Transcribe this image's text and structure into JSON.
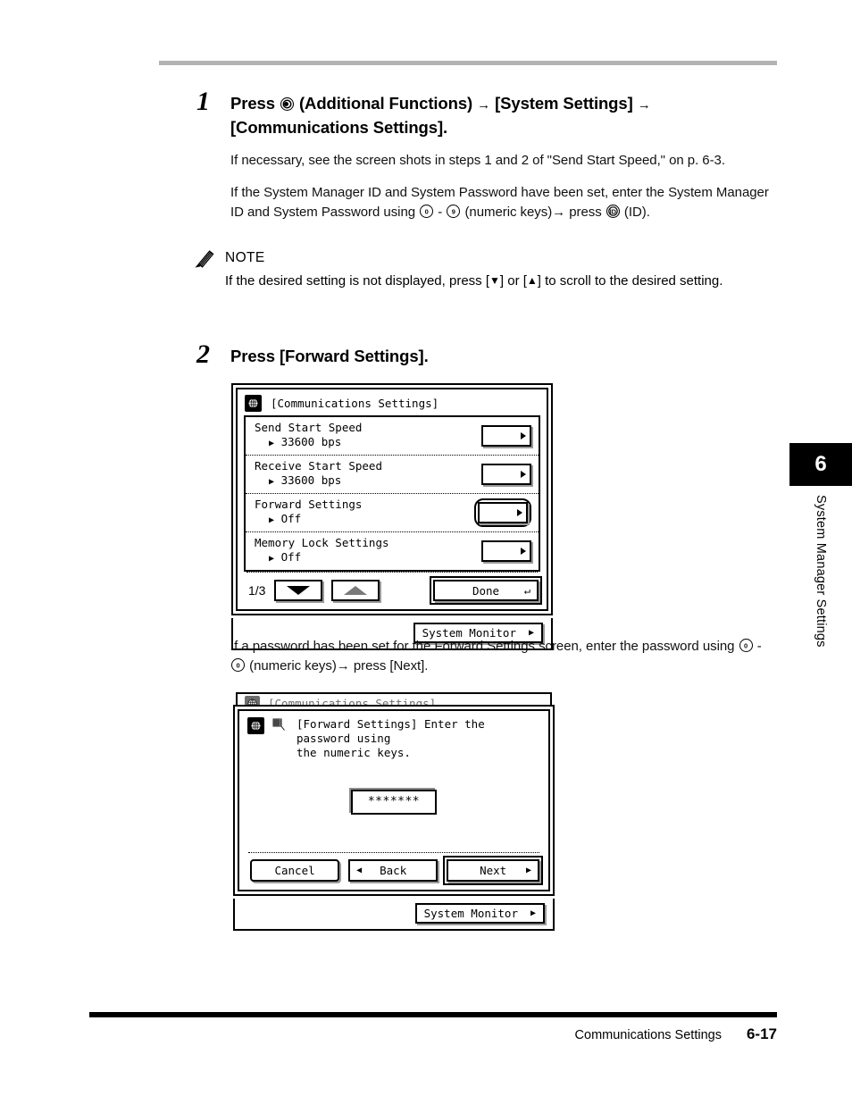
{
  "page": {
    "footer_title": "Communications Settings",
    "footer_page": "6-17",
    "chapter_number": "6",
    "chapter_label": "System Manager Settings"
  },
  "step1": {
    "number": "1",
    "heading_a": "Press",
    "heading_b": "(Additional Functions)",
    "heading_arrow1": "→",
    "heading_c": "[System Settings]",
    "heading_arrow2": "→",
    "heading_d": "[Communications Settings].",
    "para1": "If necessary, see the screen shots in steps 1 and 2 of \"Send Start Speed,\" on p. 6-3.",
    "para2_a": "If the System Manager ID and System Password have been set, enter the System Manager ID and System Password using",
    "para2_key_from": "0",
    "para2_dash": "-",
    "para2_key_to": "9",
    "para2_b": "(numeric keys)",
    "para2_arrow": "→",
    "para2_c": "press",
    "para2_key_id": "ID",
    "para2_d": "(ID)."
  },
  "note": {
    "title": "NOTE",
    "text_a": "If the desired setting is not displayed, press [",
    "down_glyph": "▼",
    "text_b": "] or [",
    "up_glyph": "▲",
    "text_c": "] to scroll to the desired setting."
  },
  "step2": {
    "number": "2",
    "heading": "Press [Forward Settings]."
  },
  "screen1": {
    "title": "[Communications Settings]",
    "rows": [
      {
        "label": "Send Start Speed",
        "value": "33600 bps",
        "highlight": false
      },
      {
        "label": "Receive Start Speed",
        "value": "33600 bps",
        "highlight": false
      },
      {
        "label": "Forward Settings",
        "value": "Off",
        "highlight": true
      },
      {
        "label": "Memory Lock Settings",
        "value": "Off",
        "highlight": false
      }
    ],
    "page_indicator": "1/3",
    "down_button": "scroll-down",
    "up_button": "scroll-up",
    "done_label": "Done",
    "done_return_glyph": "↵",
    "system_monitor_label": "System Monitor",
    "tri_right": "▶",
    "bullet": "▶"
  },
  "mid_para": {
    "text_a": "If a password has been set for the Forward Settings screen, enter the password using",
    "key_from": "0",
    "dash": "-",
    "key_to": "0",
    "text_b": "(numeric keys)",
    "arrow": "→",
    "text_c": "press [Next]."
  },
  "screen2": {
    "ghost_title": "[Communications Settings]",
    "message_line1": "[Forward Settings] Enter the password using",
    "message_line2": "the numeric keys.",
    "password_value": "*******",
    "cancel_label": "Cancel",
    "back_label": "Back",
    "next_label": "Next",
    "back_tri": "◀",
    "next_tri": "▶",
    "system_monitor_label": "System Monitor",
    "tri_right": "▶"
  }
}
